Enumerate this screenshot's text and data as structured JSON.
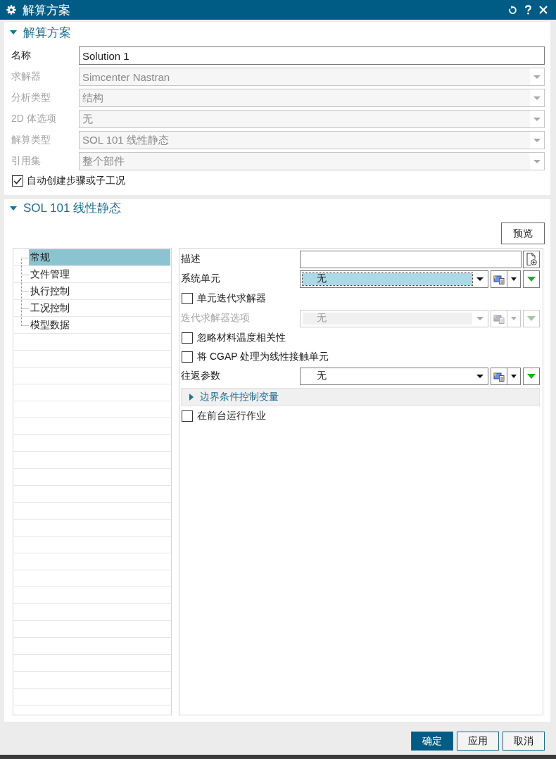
{
  "window": {
    "title": "解算方案"
  },
  "solution_section": {
    "title": "解算方案",
    "expanded": true,
    "fields": [
      {
        "label": "名称",
        "kind": "text",
        "value": "Solution 1",
        "disabled": false
      },
      {
        "label": "求解器",
        "kind": "dropdown",
        "value": "Simcenter Nastran",
        "disabled": true
      },
      {
        "label": "分析类型",
        "kind": "dropdown",
        "value": "结构",
        "disabled": true
      },
      {
        "label": "2D 体选项",
        "kind": "dropdown",
        "value": "无",
        "disabled": true
      },
      {
        "label": "解算类型",
        "kind": "dropdown",
        "value": "SOL 101 线性静态",
        "disabled": true
      },
      {
        "label": "引用集",
        "kind": "dropdown",
        "value": "整个部件",
        "disabled": true
      }
    ],
    "auto_create": {
      "label": "自动创建步骤或子工况",
      "checked": true
    }
  },
  "sol_section": {
    "title": "SOL 101 线性静态",
    "expanded": true,
    "preview_button": "预览",
    "tree": [
      {
        "label": "常规",
        "selected": true
      },
      {
        "label": "文件管理",
        "selected": false
      },
      {
        "label": "执行控制",
        "selected": false
      },
      {
        "label": "工况控制",
        "selected": false
      },
      {
        "label": "模型数据",
        "selected": false
      }
    ],
    "properties": [
      {
        "kind": "text",
        "label": "描述"
      },
      {
        "kind": "dropdown",
        "label": "系统单元",
        "value": "无",
        "disabled": false,
        "focused": true
      },
      {
        "kind": "checkbox",
        "label": "单元迭代求解器",
        "checked": false
      },
      {
        "kind": "dropdown",
        "label": "迭代求解器选项",
        "value": "无",
        "disabled": true,
        "focused": false
      },
      {
        "kind": "checkbox",
        "label": "忽略材料温度相关性",
        "checked": false
      },
      {
        "kind": "checkbox",
        "label": "将 CGAP 处理为线性接触单元",
        "checked": false
      },
      {
        "kind": "dropdown",
        "label": "往返参数",
        "value": "无",
        "disabled": false,
        "focused": false
      },
      {
        "kind": "group",
        "label": "边界条件控制变量",
        "expanded": false
      },
      {
        "kind": "checkbox",
        "label": "在前台运行作业",
        "checked": false
      }
    ]
  },
  "buttons": [
    {
      "label": "确定",
      "primary": true
    },
    {
      "label": "应用",
      "primary": false
    },
    {
      "label": "取消",
      "primary": false
    }
  ]
}
